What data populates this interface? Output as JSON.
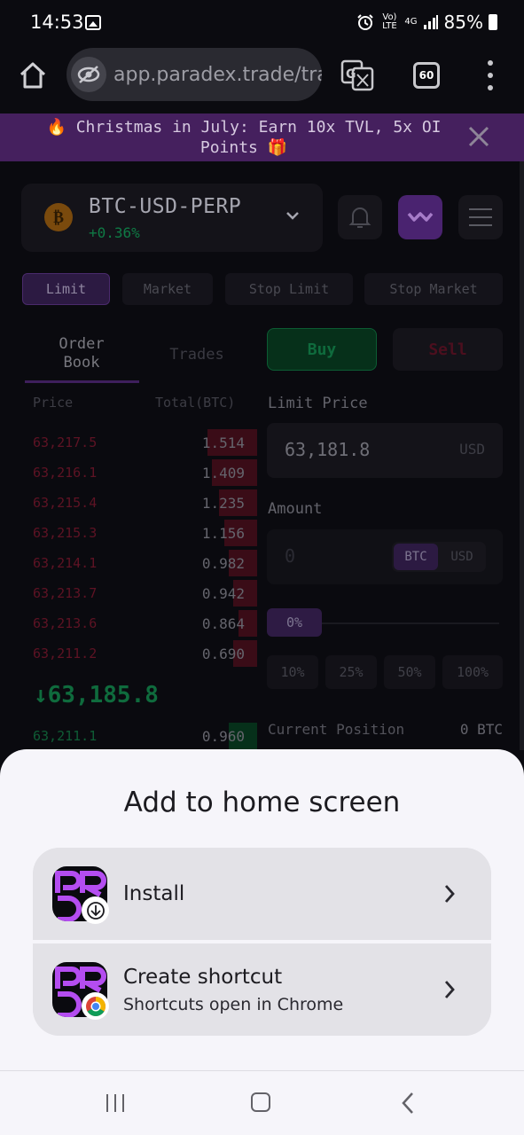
{
  "status_bar": {
    "time": "14:53",
    "network": "4G",
    "volte": "Vo) LTE",
    "battery": "85%"
  },
  "browser": {
    "url": "app.paradex.trade/tra",
    "tab_count": "60"
  },
  "banner": {
    "text": "🔥 Christmas in July: Earn 10x TVL, 5x OI Points 🎁"
  },
  "market": {
    "symbol": "BTC-USD-PERP",
    "change": "+0.36%",
    "coin_glyph": "₿"
  },
  "order_types": [
    "Limit",
    "Market",
    "Stop Limit",
    "Stop Market"
  ],
  "orderbook": {
    "tabs": [
      "Order Book",
      "Trades"
    ],
    "header_price": "Price",
    "header_total": "Total(BTC)",
    "asks": [
      {
        "price": "63,217.5",
        "total": "1.514",
        "depth": 0.21
      },
      {
        "price": "63,216.1",
        "total": "1.409",
        "depth": 0.19
      },
      {
        "price": "63,215.4",
        "total": "1.235",
        "depth": 0.16
      },
      {
        "price": "63,215.3",
        "total": "1.156",
        "depth": 0.14
      },
      {
        "price": "63,214.1",
        "total": "0.982",
        "depth": 0.12
      },
      {
        "price": "63,213.7",
        "total": "0.942",
        "depth": 0.1
      },
      {
        "price": "63,213.6",
        "total": "0.864",
        "depth": 0.08
      },
      {
        "price": "63,211.2",
        "total": "0.690",
        "depth": 0.1
      }
    ],
    "last_price": "↓63,185.8",
    "bids": [
      {
        "price": "63,211.1",
        "total": "0.960",
        "depth": 0.12
      }
    ]
  },
  "trade_form": {
    "buy_label": "Buy",
    "sell_label": "Sell",
    "limit_price_label": "Limit Price",
    "limit_price_value": "63,181.8",
    "limit_price_unit": "USD",
    "amount_label": "Amount",
    "amount_placeholder": "0",
    "unit_btc": "BTC",
    "unit_usd": "USD",
    "slider_value": "0%",
    "percent_buttons": [
      "10%",
      "25%",
      "50%",
      "100%"
    ],
    "position_label": "Current Position",
    "position_value": "0 BTC"
  },
  "sheet": {
    "title": "Add to home screen",
    "install_label": "Install",
    "shortcut_label": "Create shortcut",
    "shortcut_sub": "Shortcuts open in Chrome"
  },
  "colors": {
    "brand": "#b44df0",
    "banner": "#45205e",
    "sheet_bg": "#f6f5fa"
  }
}
